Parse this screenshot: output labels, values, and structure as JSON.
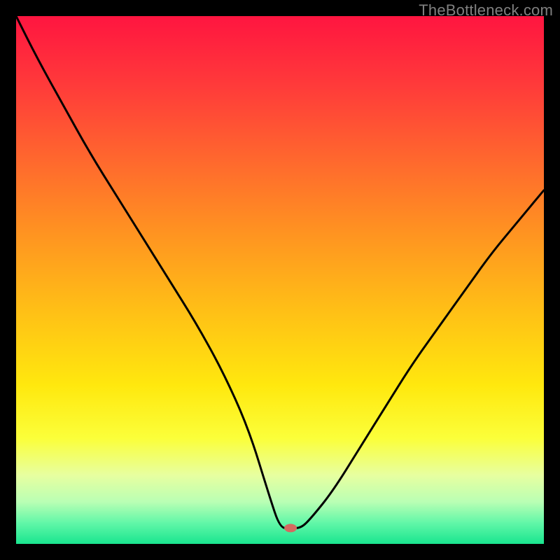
{
  "watermark": "TheBottleneck.com",
  "chart_data": {
    "type": "line",
    "title": "",
    "xlabel": "",
    "ylabel": "",
    "xlim": [
      0,
      100
    ],
    "ylim": [
      0,
      100
    ],
    "background_gradient": {
      "stops": [
        {
          "offset": 0.0,
          "color": "#ff1540"
        },
        {
          "offset": 0.13,
          "color": "#ff3a3a"
        },
        {
          "offset": 0.28,
          "color": "#ff6a2d"
        },
        {
          "offset": 0.42,
          "color": "#ff9620"
        },
        {
          "offset": 0.56,
          "color": "#ffc016"
        },
        {
          "offset": 0.7,
          "color": "#ffe80e"
        },
        {
          "offset": 0.8,
          "color": "#fbff3a"
        },
        {
          "offset": 0.87,
          "color": "#e7ffa0"
        },
        {
          "offset": 0.92,
          "color": "#baffb4"
        },
        {
          "offset": 0.96,
          "color": "#62f7a8"
        },
        {
          "offset": 1.0,
          "color": "#19e58f"
        }
      ]
    },
    "series": [
      {
        "name": "bottleneck-curve",
        "x": [
          0,
          4,
          9,
          14,
          19,
          24,
          29,
          34,
          39,
          44,
          48,
          50,
          52,
          54,
          56,
          60,
          65,
          70,
          75,
          80,
          85,
          90,
          95,
          100
        ],
        "y": [
          100,
          92,
          83,
          74,
          66,
          58,
          50,
          42,
          33,
          22,
          9,
          3,
          3,
          3,
          5,
          10,
          18,
          26,
          34,
          41,
          48,
          55,
          61,
          67
        ],
        "stroke": "#000000",
        "stroke_width": 3
      }
    ],
    "marker": {
      "x": 52,
      "y": 3,
      "rx": 9,
      "ry": 6,
      "fill": "#d46a60"
    }
  }
}
